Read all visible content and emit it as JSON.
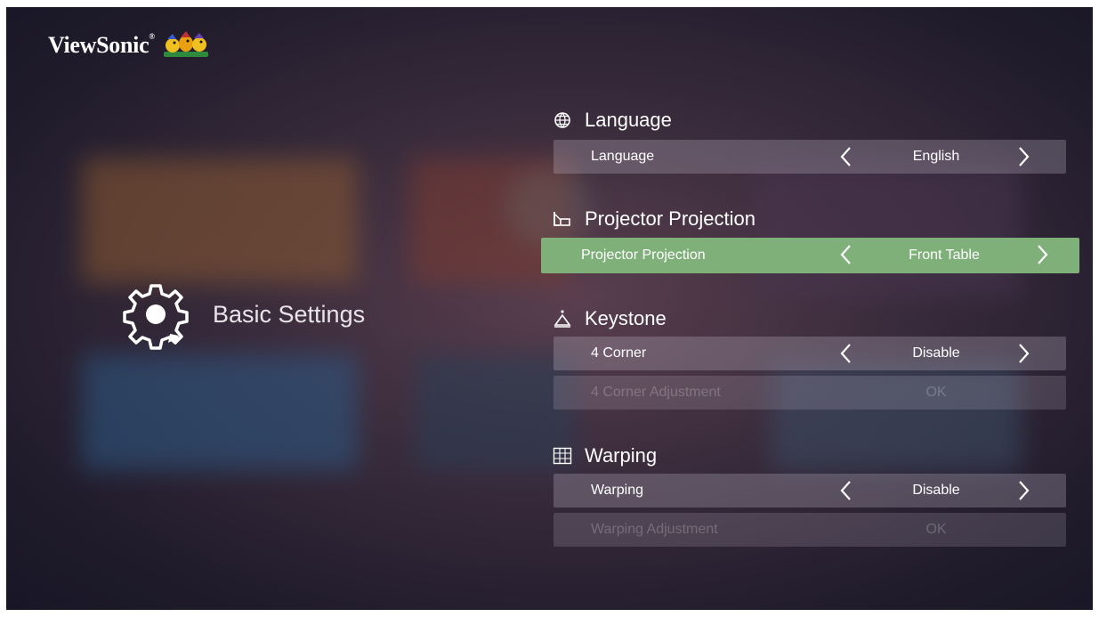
{
  "brand": {
    "name": "ViewSonic",
    "reg": "®"
  },
  "page": {
    "title": "Basic Settings",
    "icon": "gear-icon"
  },
  "sections": {
    "language": {
      "title": "Language",
      "icon": "globe-icon",
      "rows": [
        {
          "label": "Language",
          "value": "English"
        }
      ]
    },
    "projection": {
      "title": "Projector Projection",
      "icon": "projector-icon",
      "rows": [
        {
          "label": "Projector Projection",
          "value": "Front Table",
          "selected": true
        }
      ]
    },
    "keystone": {
      "title": "Keystone",
      "icon": "keystone-icon",
      "rows": [
        {
          "label": "4 Corner",
          "value": "Disable"
        },
        {
          "label": "4 Corner Adjustment",
          "value": "OK",
          "disabled": true
        }
      ]
    },
    "warping": {
      "title": "Warping",
      "icon": "grid-icon",
      "rows": [
        {
          "label": "Warping",
          "value": "Disable"
        },
        {
          "label": "Warping Adjustment",
          "value": "OK",
          "disabled": true
        }
      ]
    }
  },
  "colors": {
    "selected": "#7fb07a",
    "row": "rgba(210,200,215,0.26)",
    "text": "#ffffff"
  }
}
